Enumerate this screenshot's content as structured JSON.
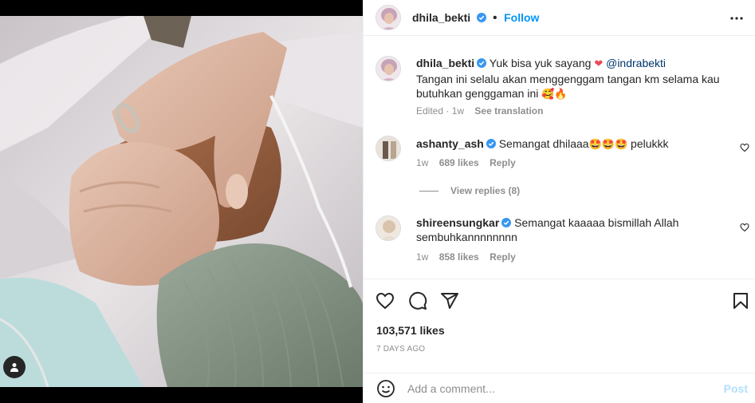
{
  "header": {
    "username": "dhila_bekti",
    "separator": "•",
    "follow_label": "Follow",
    "more_icon": "more-horizontal-icon"
  },
  "caption": {
    "username": "dhila_bekti",
    "text_before_heart": "Yuk bisa yuk sayang",
    "heart_emoji": "❤",
    "mention": "@indrabekti",
    "line2": "Tangan ini selalu akan menggenggam tangan km selama kau",
    "line3_text": "butuhkan genggaman ini",
    "line3_emojis": "🥰🔥",
    "edited": "Edited",
    "age": "1w",
    "see_translation": "See translation"
  },
  "comments": [
    {
      "username": "ashanty_ash",
      "text": "Semangat dhilaaa",
      "emojis": "🤩🤩🤩",
      "text_after": "pelukkk",
      "age": "1w",
      "likes": "689 likes",
      "reply": "Reply",
      "view_replies": "View replies (8)"
    },
    {
      "username": "shireensungkar",
      "line1": "Semangat kaaaaa bismillah Allah",
      "line2": "sembuhkannnnnnnn",
      "age": "1w",
      "likes": "858 likes",
      "reply": "Reply"
    }
  ],
  "actions": {
    "like_icon": "heart-icon",
    "comment_icon": "comment-icon",
    "share_icon": "share-icon",
    "save_icon": "bookmark-icon"
  },
  "likes": "103,571 likes",
  "timestamp": "7 DAYS AGO",
  "add_comment": {
    "placeholder": "Add a comment...",
    "post_label": "Post",
    "emoji_icon": "smiley-icon"
  },
  "colors": {
    "accent": "#0095f6",
    "post_disabled": "#b2dffc",
    "muted": "#8e8e8e",
    "verified": "#3897f0",
    "heart": "#ed4956"
  }
}
